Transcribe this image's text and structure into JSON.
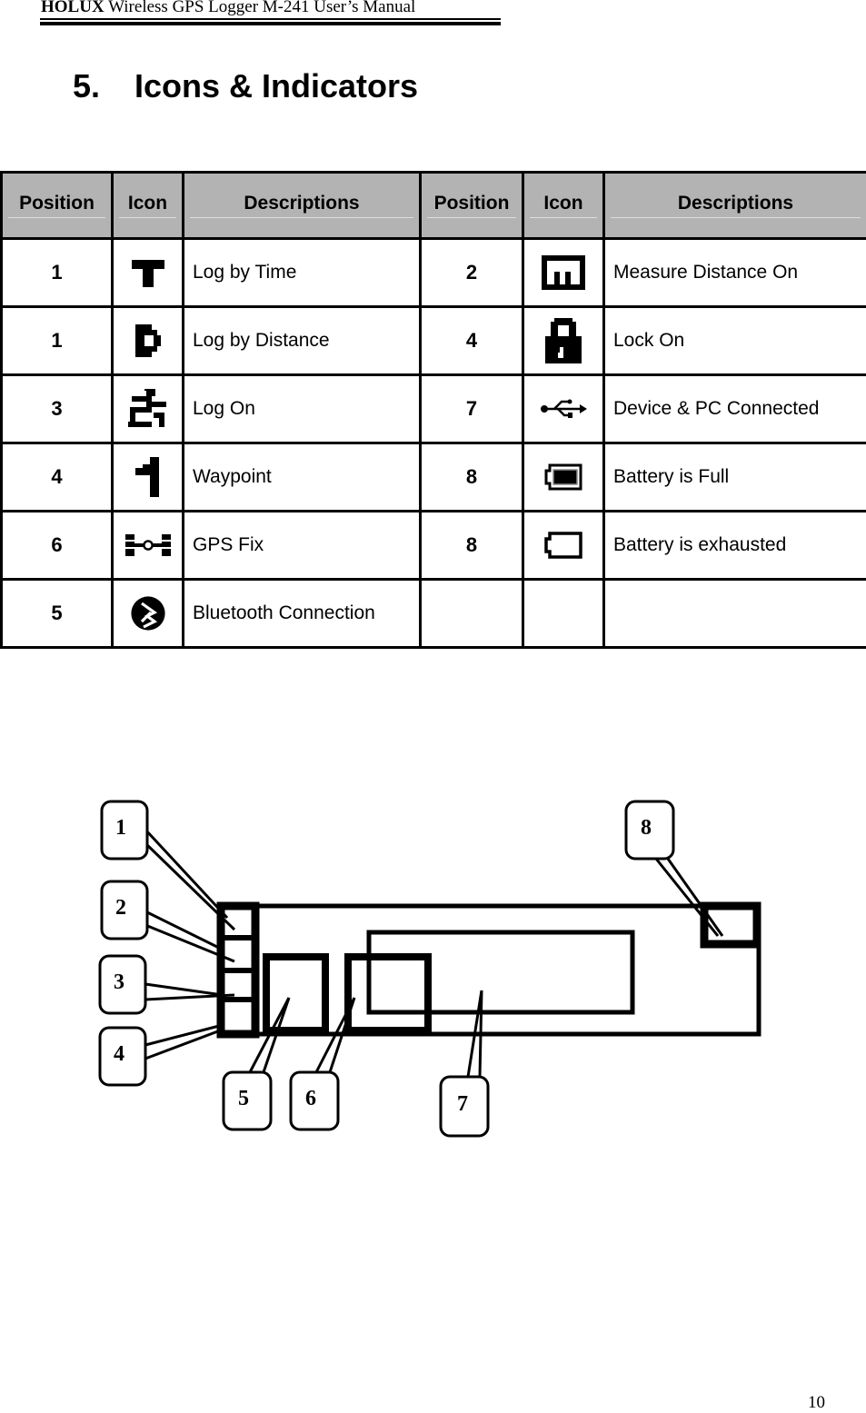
{
  "header": {
    "brand": "HOLUX",
    "title": "Wireless GPS Logger M-241 User’s Manual"
  },
  "section": {
    "number": "5.",
    "title": "Icons & Indicators"
  },
  "table": {
    "headers": [
      "Position",
      "Icon",
      "Descriptions",
      "Position",
      "Icon",
      "Descriptions"
    ],
    "rows": [
      {
        "l_pos": "1",
        "l_icon": "log-by-time-icon",
        "l_desc": "Log by Time",
        "r_pos": "2",
        "r_icon": "measure-distance-icon",
        "r_desc": "Measure Distance On"
      },
      {
        "l_pos": "1",
        "l_icon": "log-by-distance-icon",
        "l_desc": "Log by Distance",
        "r_pos": "4",
        "r_icon": "lock-icon",
        "r_desc": "Lock On"
      },
      {
        "l_pos": "3",
        "l_icon": "log-on-icon",
        "l_desc": "Log On",
        "r_pos": "7",
        "r_icon": "usb-icon",
        "r_desc": "Device & PC Connected"
      },
      {
        "l_pos": "4",
        "l_icon": "waypoint-flag-icon",
        "l_desc": "Waypoint",
        "r_pos": "8",
        "r_icon": "battery-full-icon",
        "r_desc": "Battery is Full"
      },
      {
        "l_pos": "6",
        "l_icon": "gps-satellite-icon",
        "l_desc": "GPS Fix",
        "r_pos": "8",
        "r_icon": "battery-empty-icon",
        "r_desc": "Battery is exhausted"
      },
      {
        "l_pos": "5",
        "l_icon": "bluetooth-icon",
        "l_desc": "Bluetooth Connection",
        "r_pos": "",
        "r_icon": "",
        "r_desc": ""
      }
    ]
  },
  "diagram": {
    "callouts": [
      "1",
      "2",
      "3",
      "4",
      "5",
      "6",
      "7",
      "8"
    ]
  },
  "footer": {
    "page_number": "10"
  }
}
